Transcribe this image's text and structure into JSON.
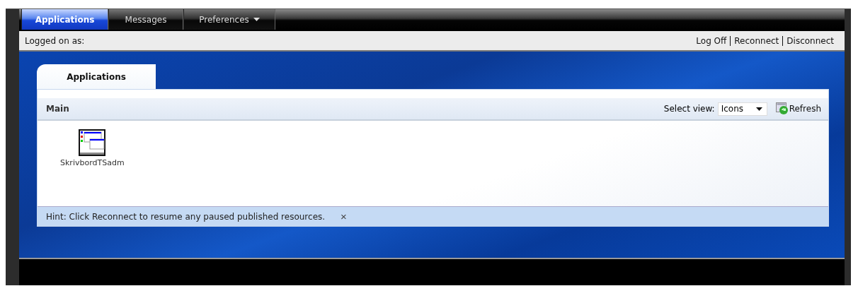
{
  "nav_tabs": [
    {
      "label": "Applications",
      "selected": true
    },
    {
      "label": "Messages",
      "selected": false
    },
    {
      "label": "Preferences",
      "selected": false,
      "has_menu": true
    }
  ],
  "login_bar": {
    "label": "Logged on as:",
    "links": [
      "Log Off",
      "Reconnect",
      "Disconnect"
    ]
  },
  "panel": {
    "tab": "Applications",
    "folder": "Main",
    "view_label": "Select view:",
    "view": "Icons",
    "refresh": "Refresh",
    "apps": [
      {
        "name": "SkrivbordTSadm"
      }
    ],
    "hint": "Hint: Click Reconnect to resume any paused published resources.",
    "close": "×"
  }
}
